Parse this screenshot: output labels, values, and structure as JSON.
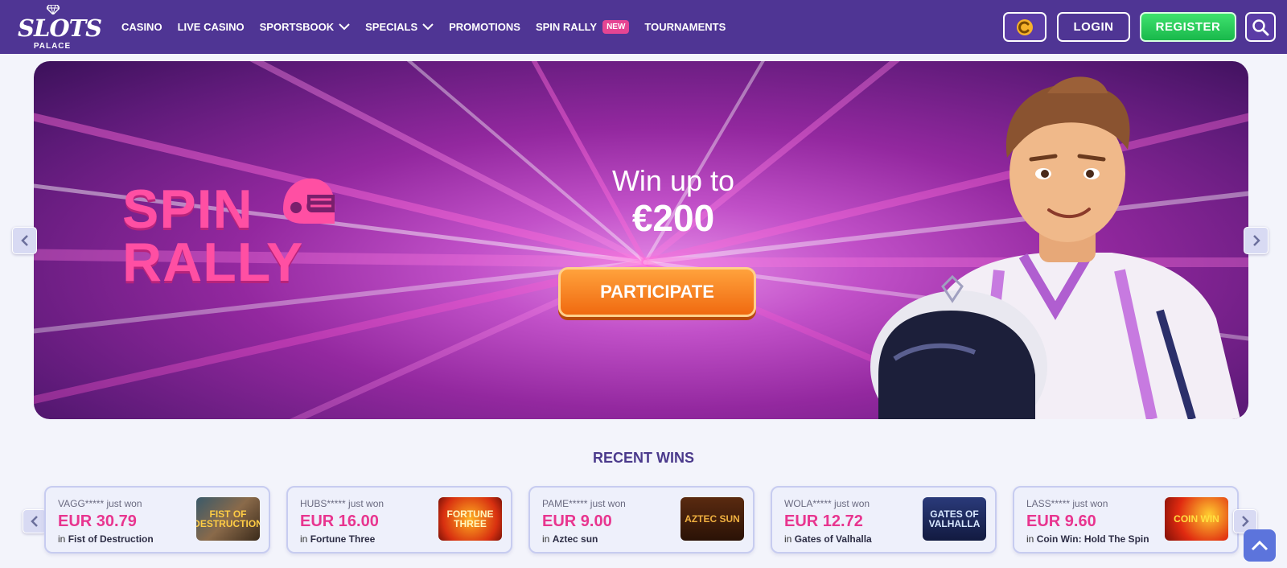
{
  "brand": {
    "word": "SLOTS",
    "sub": "PALACE"
  },
  "nav": {
    "items": [
      {
        "label": "CASINO"
      },
      {
        "label": "LIVE CASINO"
      },
      {
        "label": "SPORTSBOOK"
      },
      {
        "label": "SPECIALS"
      },
      {
        "label": "PROMOTIONS"
      },
      {
        "label": "SPIN RALLY",
        "badge": "NEW"
      },
      {
        "label": "TOURNAMENTS"
      }
    ]
  },
  "header_actions": {
    "login": "LOGIN",
    "register": "REGISTER"
  },
  "banner": {
    "logo_line1": "SPIN",
    "logo_line2": "RALLY",
    "headline": "Win up to",
    "amount": "€200",
    "cta": "PARTICIPATE"
  },
  "recent_wins": {
    "title": "RECENT WINS",
    "in_label": "in",
    "items": [
      {
        "player": "VAGG***** just won",
        "amount": "EUR 30.79",
        "game": "Fist of Destruction",
        "thumb_text": "FIST OF DESTRUCTION"
      },
      {
        "player": "HUBS***** just won",
        "amount": "EUR 16.00",
        "game": "Fortune Three",
        "thumb_text": "FORTUNE THREE"
      },
      {
        "player": "PAME***** just won",
        "amount": "EUR 9.00",
        "game": "Aztec sun",
        "thumb_text": "AZTEC SUN"
      },
      {
        "player": "WOLA***** just won",
        "amount": "EUR 12.72",
        "game": "Gates of Valhalla",
        "thumb_text": "GATES OF VALHALLA"
      },
      {
        "player": "LASS***** just won",
        "amount": "EUR 9.60",
        "game": "Coin Win: Hold The Spin",
        "thumb_text": "COIN WIN"
      }
    ]
  },
  "icons": {
    "logo_gem": "diamond-icon",
    "coin": "coin-icon",
    "search": "search-icon",
    "banner_prev": "chevron-left-icon",
    "banner_next": "chevron-right-icon",
    "scroll_top": "chevron-up-icon"
  },
  "colors": {
    "header": "#4f3594",
    "register": "#27c857",
    "cta": "#f58320",
    "amount": "#e8358f",
    "title": "#4b3a8c"
  }
}
